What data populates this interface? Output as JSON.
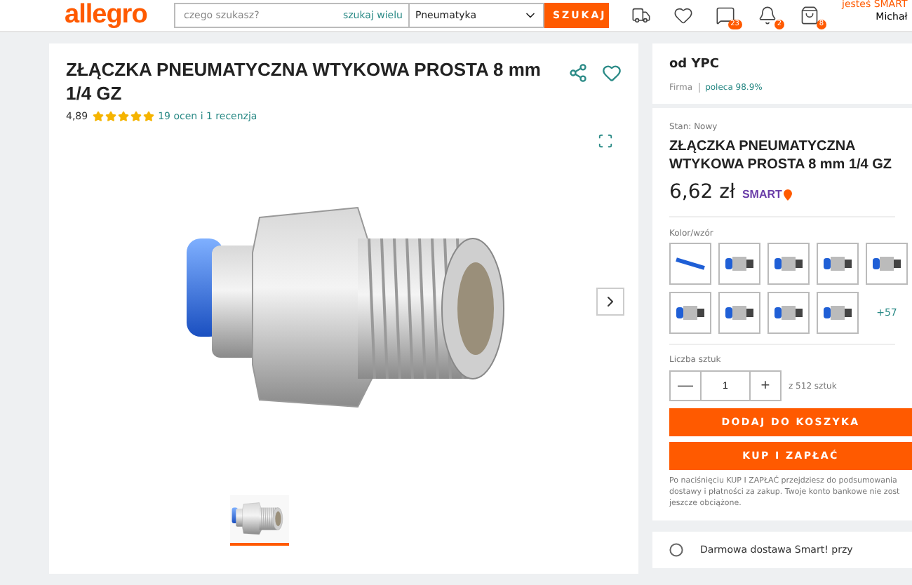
{
  "header": {
    "logo": "allegro",
    "search": {
      "placeholder": "czego szukasz?"
    },
    "search_many": "szukaj wielu",
    "category": "Pneumatyka",
    "search_button": "SZUKAJ",
    "icons": [
      {
        "kind": "truck"
      },
      {
        "kind": "heart"
      },
      {
        "kind": "chat",
        "badge": "23"
      },
      {
        "kind": "bell",
        "badge": "2"
      },
      {
        "kind": "bag",
        "badge": "8"
      }
    ],
    "user": {
      "smart": "jesteś SMART",
      "name": "Michał"
    }
  },
  "product": {
    "title": "ZŁĄCZKA PNEUMATYCZNA WTYKOWA PROSTA 8 mm 1/4 GZ",
    "rating": "4,89",
    "stars": 5,
    "reviews": "19 ocen i 1 recenzja",
    "thumbnails": [
      {
        "selected": true
      }
    ]
  },
  "seller": {
    "name": "od YPC",
    "type": "Firma",
    "recommend": "poleca 98.9%"
  },
  "offer": {
    "condition": "Stan: Nowy",
    "title": "ZŁĄCZKA PNEUMATYCZNA WTYKOWA PROSTA 8 mm 1/4 GZ",
    "price": "6,62 zł",
    "smart": "SMART",
    "variants_label": "Kolor/wzór",
    "variants": [
      {
        "kind": "tube"
      },
      {
        "kind": "fitting"
      },
      {
        "kind": "fitting"
      },
      {
        "kind": "fitting"
      },
      {
        "kind": "fitting"
      },
      {
        "kind": "fitting"
      },
      {
        "kind": "fitting"
      },
      {
        "kind": "fitting"
      },
      {
        "kind": "fitting"
      }
    ],
    "more_variants": "+57",
    "quantity_label": "Liczba sztuk",
    "quantity": "1",
    "minus": "—",
    "plus": "+",
    "stock": "z 512 sztuk",
    "add_to_cart": "DODAJ DO KOSZYKA",
    "buy_now": "KUP I ZAPŁAĆ",
    "note": [
      "Po naciśnięciu KUP I ZAPŁAĆ przejdziesz do podsumowania",
      "dostawy i płatności za zakup. Twoje konto bankowe nie zost",
      "jeszcze obciążone."
    ]
  },
  "delivery": {
    "text": "Darmowa dostawa Smart! przy"
  }
}
